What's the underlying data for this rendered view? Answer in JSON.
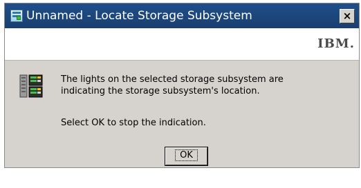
{
  "window": {
    "title": "Unnamed - Locate Storage Subsystem",
    "close_label": "×",
    "icon": "storage-manager-app-icon"
  },
  "banner": {
    "logo_text": "IBM."
  },
  "dialog": {
    "icon": "storage-subsystem-icon",
    "message_line1": "The lights on the selected storage subsystem are",
    "message_line2": "indicating the storage subsystem's location.",
    "instruction": "Select OK to stop the indication.",
    "ok_label": "OK"
  },
  "colors": {
    "titlebar": "#1e4f8b",
    "dialog_background": "#d6d3ce",
    "banner_background": "#ffffff",
    "text": "#000000"
  }
}
